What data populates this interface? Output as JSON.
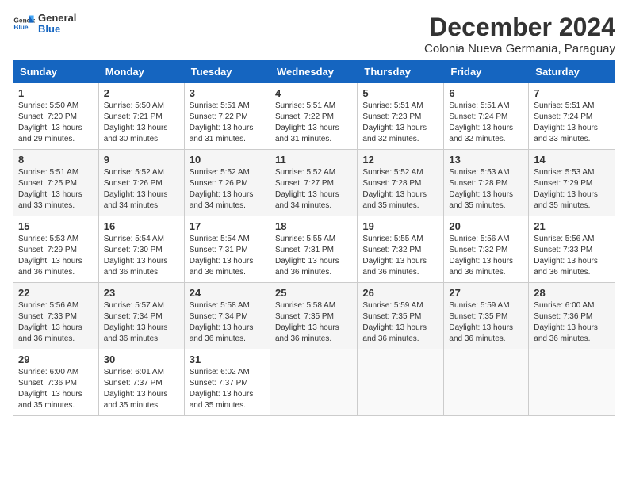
{
  "header": {
    "logo_general": "General",
    "logo_blue": "Blue",
    "title": "December 2024",
    "subtitle": "Colonia Nueva Germania, Paraguay"
  },
  "calendar": {
    "headers": [
      "Sunday",
      "Monday",
      "Tuesday",
      "Wednesday",
      "Thursday",
      "Friday",
      "Saturday"
    ],
    "weeks": [
      [
        {
          "day": "1",
          "info": "Sunrise: 5:50 AM\nSunset: 7:20 PM\nDaylight: 13 hours and 29 minutes."
        },
        {
          "day": "2",
          "info": "Sunrise: 5:50 AM\nSunset: 7:21 PM\nDaylight: 13 hours and 30 minutes."
        },
        {
          "day": "3",
          "info": "Sunrise: 5:51 AM\nSunset: 7:22 PM\nDaylight: 13 hours and 31 minutes."
        },
        {
          "day": "4",
          "info": "Sunrise: 5:51 AM\nSunset: 7:22 PM\nDaylight: 13 hours and 31 minutes."
        },
        {
          "day": "5",
          "info": "Sunrise: 5:51 AM\nSunset: 7:23 PM\nDaylight: 13 hours and 32 minutes."
        },
        {
          "day": "6",
          "info": "Sunrise: 5:51 AM\nSunset: 7:24 PM\nDaylight: 13 hours and 32 minutes."
        },
        {
          "day": "7",
          "info": "Sunrise: 5:51 AM\nSunset: 7:24 PM\nDaylight: 13 hours and 33 minutes."
        }
      ],
      [
        {
          "day": "8",
          "info": "Sunrise: 5:51 AM\nSunset: 7:25 PM\nDaylight: 13 hours and 33 minutes."
        },
        {
          "day": "9",
          "info": "Sunrise: 5:52 AM\nSunset: 7:26 PM\nDaylight: 13 hours and 34 minutes."
        },
        {
          "day": "10",
          "info": "Sunrise: 5:52 AM\nSunset: 7:26 PM\nDaylight: 13 hours and 34 minutes."
        },
        {
          "day": "11",
          "info": "Sunrise: 5:52 AM\nSunset: 7:27 PM\nDaylight: 13 hours and 34 minutes."
        },
        {
          "day": "12",
          "info": "Sunrise: 5:52 AM\nSunset: 7:28 PM\nDaylight: 13 hours and 35 minutes."
        },
        {
          "day": "13",
          "info": "Sunrise: 5:53 AM\nSunset: 7:28 PM\nDaylight: 13 hours and 35 minutes."
        },
        {
          "day": "14",
          "info": "Sunrise: 5:53 AM\nSunset: 7:29 PM\nDaylight: 13 hours and 35 minutes."
        }
      ],
      [
        {
          "day": "15",
          "info": "Sunrise: 5:53 AM\nSunset: 7:29 PM\nDaylight: 13 hours and 36 minutes."
        },
        {
          "day": "16",
          "info": "Sunrise: 5:54 AM\nSunset: 7:30 PM\nDaylight: 13 hours and 36 minutes."
        },
        {
          "day": "17",
          "info": "Sunrise: 5:54 AM\nSunset: 7:31 PM\nDaylight: 13 hours and 36 minutes."
        },
        {
          "day": "18",
          "info": "Sunrise: 5:55 AM\nSunset: 7:31 PM\nDaylight: 13 hours and 36 minutes."
        },
        {
          "day": "19",
          "info": "Sunrise: 5:55 AM\nSunset: 7:32 PM\nDaylight: 13 hours and 36 minutes."
        },
        {
          "day": "20",
          "info": "Sunrise: 5:56 AM\nSunset: 7:32 PM\nDaylight: 13 hours and 36 minutes."
        },
        {
          "day": "21",
          "info": "Sunrise: 5:56 AM\nSunset: 7:33 PM\nDaylight: 13 hours and 36 minutes."
        }
      ],
      [
        {
          "day": "22",
          "info": "Sunrise: 5:56 AM\nSunset: 7:33 PM\nDaylight: 13 hours and 36 minutes."
        },
        {
          "day": "23",
          "info": "Sunrise: 5:57 AM\nSunset: 7:34 PM\nDaylight: 13 hours and 36 minutes."
        },
        {
          "day": "24",
          "info": "Sunrise: 5:58 AM\nSunset: 7:34 PM\nDaylight: 13 hours and 36 minutes."
        },
        {
          "day": "25",
          "info": "Sunrise: 5:58 AM\nSunset: 7:35 PM\nDaylight: 13 hours and 36 minutes."
        },
        {
          "day": "26",
          "info": "Sunrise: 5:59 AM\nSunset: 7:35 PM\nDaylight: 13 hours and 36 minutes."
        },
        {
          "day": "27",
          "info": "Sunrise: 5:59 AM\nSunset: 7:35 PM\nDaylight: 13 hours and 36 minutes."
        },
        {
          "day": "28",
          "info": "Sunrise: 6:00 AM\nSunset: 7:36 PM\nDaylight: 13 hours and 36 minutes."
        }
      ],
      [
        {
          "day": "29",
          "info": "Sunrise: 6:00 AM\nSunset: 7:36 PM\nDaylight: 13 hours and 35 minutes."
        },
        {
          "day": "30",
          "info": "Sunrise: 6:01 AM\nSunset: 7:37 PM\nDaylight: 13 hours and 35 minutes."
        },
        {
          "day": "31",
          "info": "Sunrise: 6:02 AM\nSunset: 7:37 PM\nDaylight: 13 hours and 35 minutes."
        },
        null,
        null,
        null,
        null
      ]
    ]
  }
}
